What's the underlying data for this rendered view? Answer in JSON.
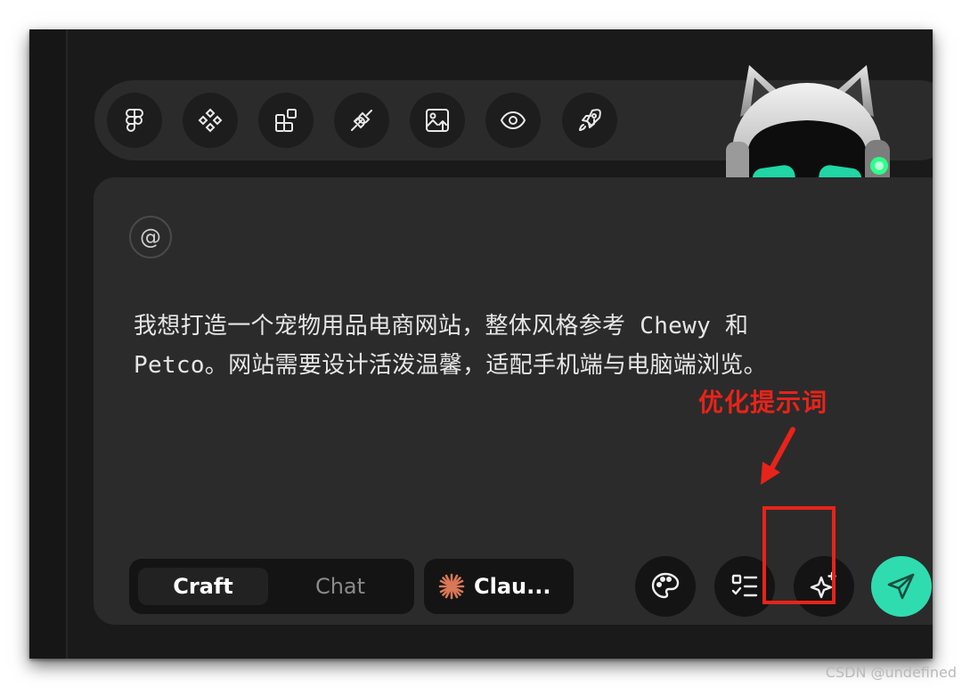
{
  "toolbar": {
    "buttons": [
      {
        "icon": "figma-icon"
      },
      {
        "icon": "components-icon"
      },
      {
        "icon": "blocks-icon"
      },
      {
        "icon": "plug-icon"
      },
      {
        "icon": "image-upload-icon"
      },
      {
        "icon": "eye-icon"
      },
      {
        "icon": "rocket-icon"
      }
    ]
  },
  "mascot": {
    "icon": "robot-cat-mascot"
  },
  "panel": {
    "mention_symbol": "@",
    "prompt_line1": "我想打造一个宠物用品电商网站，整体风格参考 Chewy 和",
    "prompt_line2": "Petco。网站需要设计活泼温馨，适配手机端与电脑端浏览。"
  },
  "annotation": {
    "label": "优化提示词",
    "color": "#e8231a"
  },
  "mode": {
    "craft": "Craft",
    "chat": "Chat",
    "active": "Craft"
  },
  "model": {
    "label": "Clau...",
    "icon": "claude-starburst-icon",
    "accent": "#d97757"
  },
  "actions": {
    "palette": "palette-icon",
    "tasks": "checklist-icon",
    "enhance": "sparkle-icon",
    "send": "send-icon",
    "send_color": "#2fdcaf"
  },
  "watermark": "CSDN @undefined"
}
